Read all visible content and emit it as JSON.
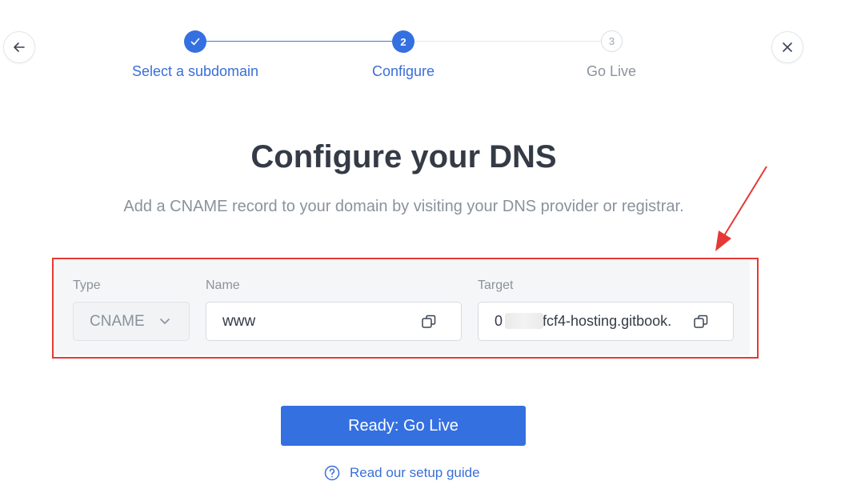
{
  "stepper": {
    "steps": [
      {
        "number": "1",
        "label": "Select a subdomain",
        "state": "complete"
      },
      {
        "number": "2",
        "label": "Configure",
        "state": "active"
      },
      {
        "number": "3",
        "label": "Go Live",
        "state": "pending"
      }
    ]
  },
  "page": {
    "title": "Configure your DNS",
    "subtitle": "Add a CNAME record to your domain by visiting your DNS provider or registrar."
  },
  "record": {
    "type_label": "Type",
    "type_value": "CNAME",
    "name_label": "Name",
    "name_value": "www",
    "target_label": "Target",
    "target_value": "0        dfcf4-hosting.gitbook."
  },
  "actions": {
    "go_live_label": "Ready: Go Live",
    "guide_label": "Read our setup guide"
  },
  "colors": {
    "accent": "#3470e0",
    "annotation": "#e53935"
  },
  "icons": {
    "back": "arrow-left-icon",
    "close": "close-icon",
    "check": "check-icon",
    "chevron": "chevron-down-icon",
    "copy": "copy-icon",
    "help": "question-circle-icon"
  }
}
